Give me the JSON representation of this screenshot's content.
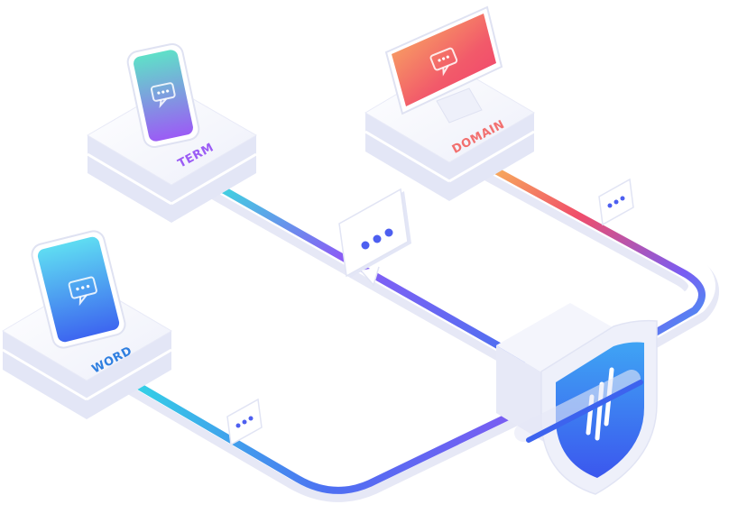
{
  "labels": {
    "term": "TERM",
    "domain": "DOMAIN",
    "word": "WORD"
  },
  "colors": {
    "term_label": "#9b5cf5",
    "domain_label": "#f2706f",
    "word_label": "#2f7fe0",
    "platform_top": "#f3f4fb",
    "platform_side": "#e1e4f5",
    "shield": "#3d7df0",
    "pipe_purple": "#7a5cf2",
    "pipe_blue": "#3ab6f3",
    "pipe_red": "#f05a6e",
    "pipe_orange": "#f7a85a"
  },
  "icons": {
    "device_screen": "chat-bubble-icon",
    "message_card": "ellipsis-message-icon",
    "security_gateway": "shield-icon"
  }
}
